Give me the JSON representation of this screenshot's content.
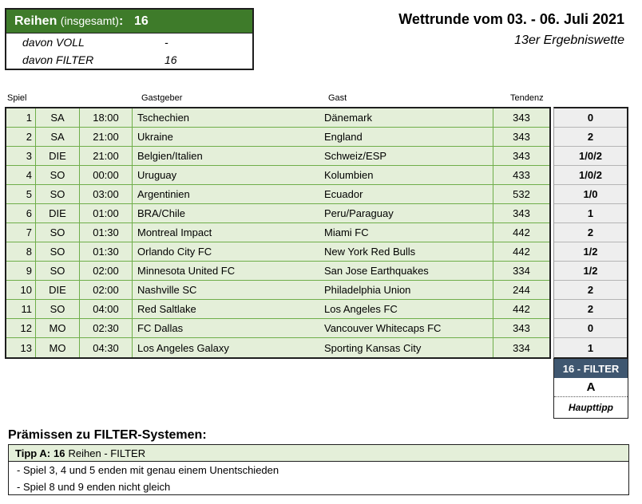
{
  "summary": {
    "label_main": "Reihen",
    "label_small": "(insgesamt)",
    "colon": ":",
    "total": "16",
    "rows": [
      {
        "label": "davon VOLL",
        "value": "-"
      },
      {
        "label": "davon FILTER",
        "value": "16"
      }
    ]
  },
  "header": {
    "title": "Wettrunde vom 03. - 06. Juli 2021",
    "subtitle": "13er Ergebniswette"
  },
  "columns": {
    "spiel": "Spiel",
    "host": "Gastgeber",
    "guest": "Gast",
    "tendenz": "Tendenz"
  },
  "matches": [
    {
      "num": "1",
      "day": "SA",
      "time": "18:00",
      "host": "Tschechien",
      "guest": "Dänemark",
      "tendenz": "343",
      "tip": "0"
    },
    {
      "num": "2",
      "day": "SA",
      "time": "21:00",
      "host": "Ukraine",
      "guest": "England",
      "tendenz": "343",
      "tip": "2"
    },
    {
      "num": "3",
      "day": "DIE",
      "time": "21:00",
      "host": "Belgien/Italien",
      "guest": "Schweiz/ESP",
      "tendenz": "343",
      "tip": "1/0/2"
    },
    {
      "num": "4",
      "day": "SO",
      "time": "00:00",
      "host": "Uruguay",
      "guest": "Kolumbien",
      "tendenz": "433",
      "tip": "1/0/2"
    },
    {
      "num": "5",
      "day": "SO",
      "time": "03:00",
      "host": "Argentinien",
      "guest": "Ecuador",
      "tendenz": "532",
      "tip": "1/0"
    },
    {
      "num": "6",
      "day": "DIE",
      "time": "01:00",
      "host": "BRA/Chile",
      "guest": "Peru/Paraguay",
      "tendenz": "343",
      "tip": "1"
    },
    {
      "num": "7",
      "day": "SO",
      "time": "01:30",
      "host": "Montreal Impact",
      "guest": "Miami FC",
      "tendenz": "442",
      "tip": "2"
    },
    {
      "num": "8",
      "day": "SO",
      "time": "01:30",
      "host": "Orlando City FC",
      "guest": "New York Red Bulls",
      "tendenz": "442",
      "tip": "1/2"
    },
    {
      "num": "9",
      "day": "SO",
      "time": "02:00",
      "host": "Minnesota United FC",
      "guest": "San Jose Earthquakes",
      "tendenz": "334",
      "tip": "1/2"
    },
    {
      "num": "10",
      "day": "DIE",
      "time": "02:00",
      "host": "Nashville SC",
      "guest": "Philadelphia Union",
      "tendenz": "244",
      "tip": "2"
    },
    {
      "num": "11",
      "day": "SO",
      "time": "04:00",
      "host": "Red Saltlake",
      "guest": "Los Angeles FC",
      "tendenz": "442",
      "tip": "2"
    },
    {
      "num": "12",
      "day": "MO",
      "time": "02:30",
      "host": "FC Dallas",
      "guest": "Vancouver Whitecaps FC",
      "tendenz": "343",
      "tip": "0"
    },
    {
      "num": "13",
      "day": "MO",
      "time": "04:30",
      "host": "Los Angeles Galaxy",
      "guest": "Sporting Kansas City",
      "tendenz": "334",
      "tip": "1"
    }
  ],
  "filter_box": {
    "header": "16 - FILTER",
    "letter": "A",
    "label": "Haupttipp"
  },
  "premises": {
    "title": "Prämissen zu FILTER-Systemen:",
    "tip_label": "Tipp A:",
    "tip_count": "16",
    "tip_text": "Reihen - FILTER",
    "lines": [
      "- Spiel 3, 4 und 5 enden mit genau einem Unentschieden",
      "- Spiel 8 und 9 enden nicht gleich"
    ]
  },
  "colors": {
    "green_header": "#3e7b2a",
    "row_fill": "#e4efd9",
    "grid_green": "#6fae4a",
    "filter_header": "#3f5770",
    "tip_fill": "#eeeeee"
  }
}
